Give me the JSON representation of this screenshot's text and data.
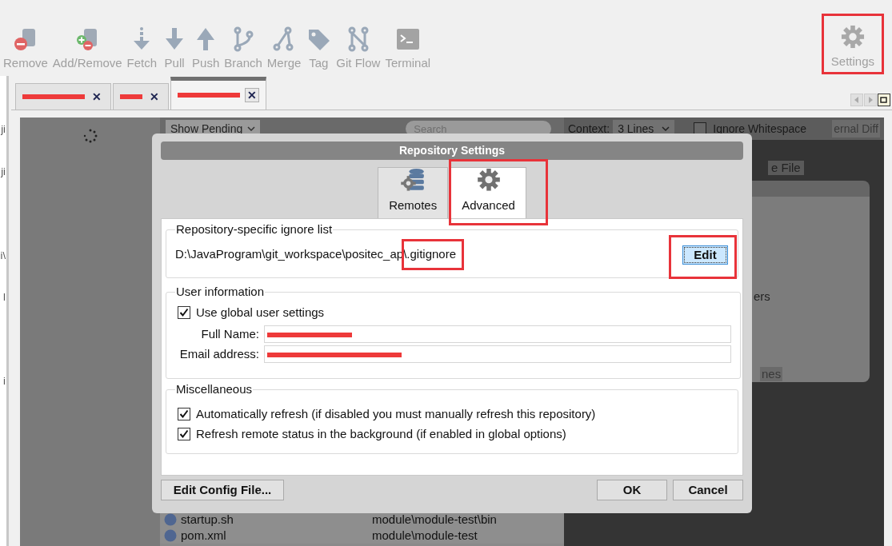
{
  "toolbar": {
    "buttons": [
      {
        "label": "Remove"
      },
      {
        "label": "Add/Remove"
      },
      {
        "label": "Fetch"
      },
      {
        "label": "Pull"
      },
      {
        "label": "Push"
      },
      {
        "label": "Branch"
      },
      {
        "label": "Merge"
      },
      {
        "label": "Tag"
      },
      {
        "label": "Git Flow"
      },
      {
        "label": "Terminal"
      }
    ],
    "settings": {
      "label": "Settings",
      "highlighted": true
    }
  },
  "sidebar_fragments": [
    "ji",
    "ji",
    "i\\",
    "l",
    "i"
  ],
  "repo_tabs": [
    {
      "redacted": true,
      "close": "✕",
      "selected": false
    },
    {
      "redacted": true,
      "close": "✕",
      "selected": false
    },
    {
      "redacted": true,
      "close": "✕",
      "selected": true
    }
  ],
  "background": {
    "show_pending": "Show Pending",
    "search_placeholder": "Search",
    "context_label": "Context:",
    "context_value": "3 Lines",
    "ignore_whitespace": {
      "label": "Ignore Whitespace",
      "checked": false
    },
    "external_diff": "ernal Diff",
    "file_chip": "e File",
    "panel_text": "ers",
    "lines_chip": "nes",
    "files": [
      {
        "name": "startup.sh",
        "path": "module\\module-test\\bin"
      },
      {
        "name": "pom.xml",
        "path": "module\\module-test"
      }
    ]
  },
  "dialog": {
    "title": "Repository Settings",
    "tabs": [
      {
        "label": "Remotes",
        "selected": false,
        "highlighted": false
      },
      {
        "label": "Advanced",
        "selected": true,
        "highlighted": true
      }
    ],
    "ignore_list": {
      "title": "Repository-specific ignore list",
      "path": "D:\\JavaProgram\\git_workspace\\positec_ap",
      "file": "\\.gitignore",
      "file_highlighted": true,
      "edit_button": {
        "label": "Edit",
        "highlighted": true
      }
    },
    "user_information": {
      "title": "User information",
      "use_global": {
        "label": "Use global user settings",
        "checked": true
      },
      "fields": [
        {
          "label": "Full Name:",
          "redacted": true
        },
        {
          "label": "Email address:",
          "redacted": true
        }
      ]
    },
    "miscellaneous": {
      "title": "Miscellaneous",
      "options": [
        {
          "label": "Automatically refresh (if disabled you must manually refresh this repository)",
          "checked": true
        },
        {
          "label": "Refresh remote status in the background (if enabled in global options)",
          "checked": true
        }
      ]
    },
    "buttons": {
      "edit_config": "Edit Config File...",
      "ok": "OK",
      "cancel": "Cancel"
    }
  }
}
